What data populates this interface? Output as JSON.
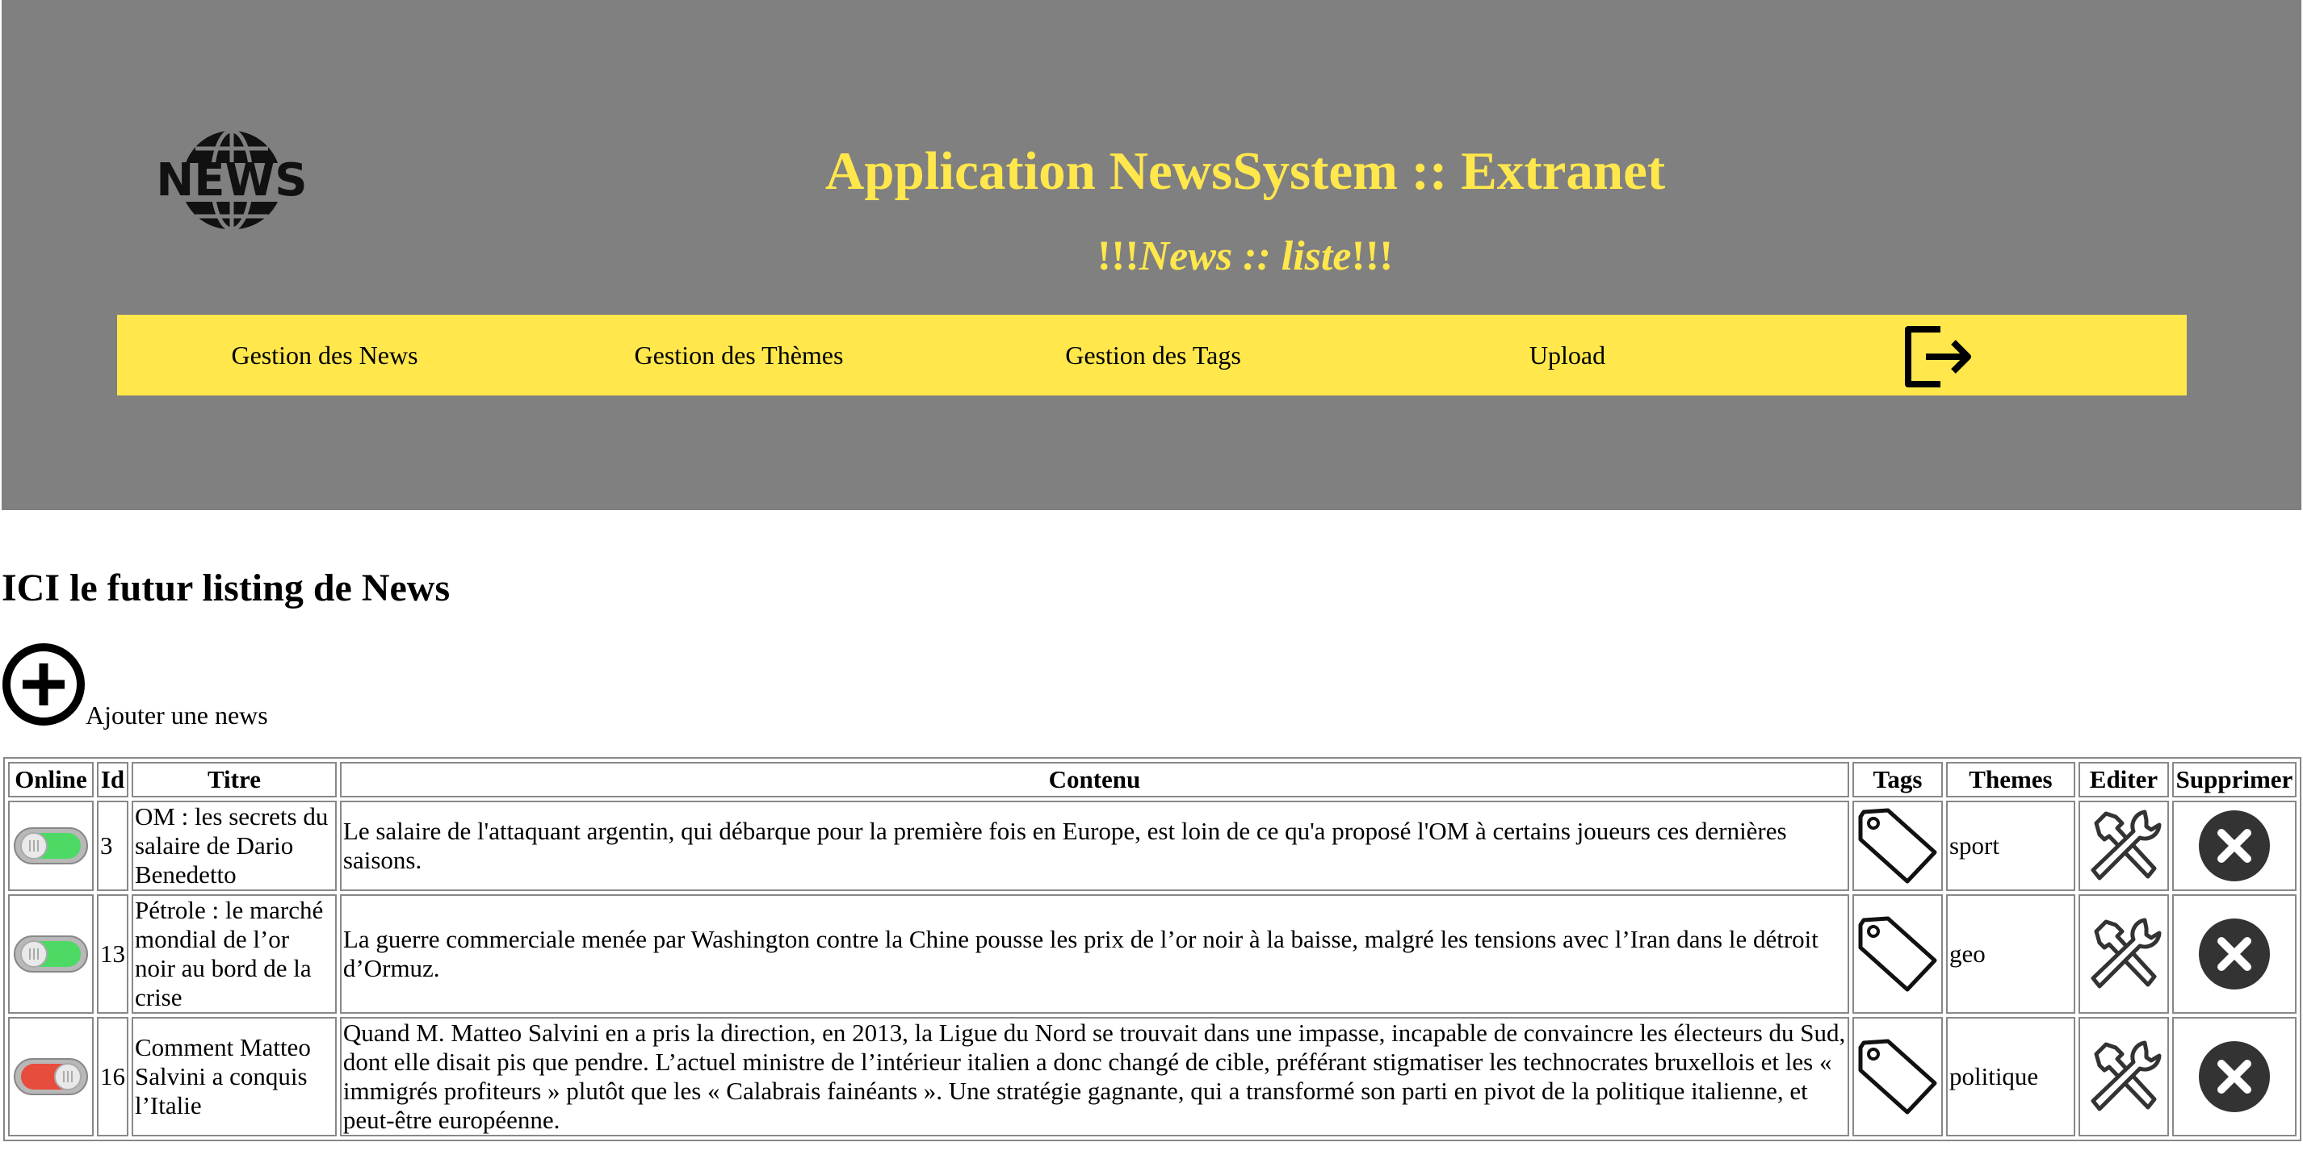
{
  "header": {
    "logo_text": "NEWS",
    "title": "Application NewsSystem :: Extranet",
    "subtitle_prefix": "!!!",
    "subtitle_main": "News :: liste",
    "subtitle_suffix": "!!!",
    "nav": [
      {
        "label": "Gestion des News"
      },
      {
        "label": "Gestion des Thèmes"
      },
      {
        "label": "Gestion des Tags"
      },
      {
        "label": "Upload"
      }
    ],
    "logout_icon": "logout-icon"
  },
  "main": {
    "title": "ICI le futur listing de News",
    "add_label": "Ajouter une news",
    "add_icon": "plus-circle-icon"
  },
  "table": {
    "columns": [
      "Online",
      "Id",
      "Titre",
      "Contenu",
      "Tags",
      "Themes",
      "Editer",
      "Supprimer"
    ],
    "rows": [
      {
        "online": true,
        "id": "3",
        "titre": "OM : les secrets du salaire de Dario Benedetto",
        "contenu": "Le salaire de l'attaquant argentin, qui débarque pour la première fois en Europe, est loin de ce qu'a proposé l'OM à certains joueurs ces dernières saisons.",
        "theme": "sport"
      },
      {
        "online": true,
        "id": "13",
        "titre": "Pétrole : le marché mondial de l’or noir au bord de la crise",
        "contenu": "La guerre commerciale menée par Washington contre la Chine pousse les prix de l’or noir à la baisse, malgré les tensions avec l’Iran dans le détroit d’Ormuz.",
        "theme": "geo"
      },
      {
        "online": false,
        "id": "16",
        "titre": "Comment Matteo Salvini a conquis l’Italie",
        "contenu": "Quand M. Matteo Salvini en a pris la direction, en 2013, la Ligue du Nord se trouvait dans une impasse, incapable de convaincre les électeurs du Sud, dont elle disait pis que pendre. L’actuel ministre de l’intérieur italien a donc changé de cible, préférant stigmatiser les technocrates bruxellois et les « immigrés profiteurs » plutôt que les « Calabrais fainéants ». Une stratégie gagnante, qui a transformé son parti en pivot de la politique italienne, et peut-être européenne.",
        "theme": "politique"
      }
    ],
    "icons": {
      "tags": "tag-icon",
      "edit": "tools-icon",
      "delete": "delete-icon",
      "online_on": "toggle-on-icon",
      "online_off": "toggle-off-icon"
    }
  },
  "colors": {
    "header_bg": "#808080",
    "accent_yellow": "#ffe74c",
    "toggle_on": "#4cd964",
    "toggle_off": "#e74c3c",
    "delete_bg": "#333333"
  }
}
